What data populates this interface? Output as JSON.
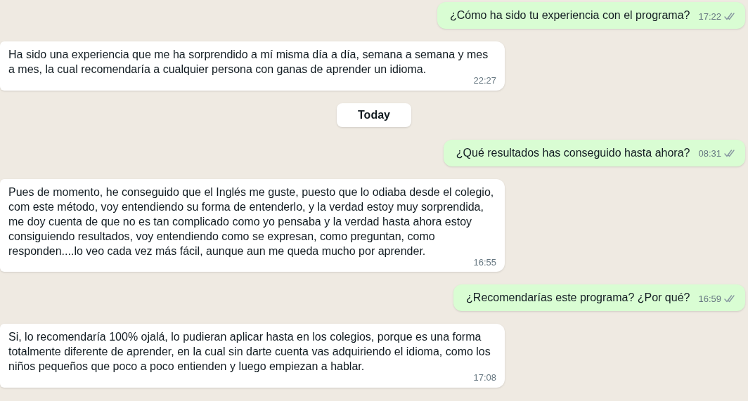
{
  "messages": [
    {
      "kind": "outgoing",
      "text": "¿Cómo ha sido tu experiencia con el programa?",
      "time": "17:22"
    },
    {
      "kind": "incoming",
      "text": "Ha sido una experiencia que me ha sorprendido a mí misma día a día, semana a semana y mes a mes,  la cual recomendaría a cualquier persona con ganas de aprender un idioma.",
      "time": "22:27"
    },
    {
      "kind": "date",
      "text": "Today"
    },
    {
      "kind": "outgoing",
      "text": "¿Qué resultados has conseguido hasta ahora?",
      "time": "08:31"
    },
    {
      "kind": "incoming",
      "text": "Pues de momento, he conseguido que el Inglés me guste, puesto que lo odiaba desde el colegio, com este método, voy entendiendo su forma de entenderlo, y la verdad estoy muy sorprendida, me doy cuenta de que no es tan complicado como yo pensaba y la verdad hasta ahora estoy consiguiendo resultados, voy entendiendo como se expresan, como preguntan, como responden....lo veo cada vez más fácil, aunque aun me queda mucho por aprender.",
      "time": "16:55"
    },
    {
      "kind": "outgoing",
      "text": "¿Recomendarías este programa? ¿Por qué?",
      "time": "16:59"
    },
    {
      "kind": "incoming",
      "text": "Si, lo recomendaría 100% ojalá, lo pudieran aplicar hasta en los colegios, porque es una forma totalmente diferente de aprender, en la cual sin darte cuenta vas adquiriendo el idioma, como los niños pequeños que poco a poco entienden y luego empiezan a hablar.",
      "time": "17:08"
    }
  ]
}
